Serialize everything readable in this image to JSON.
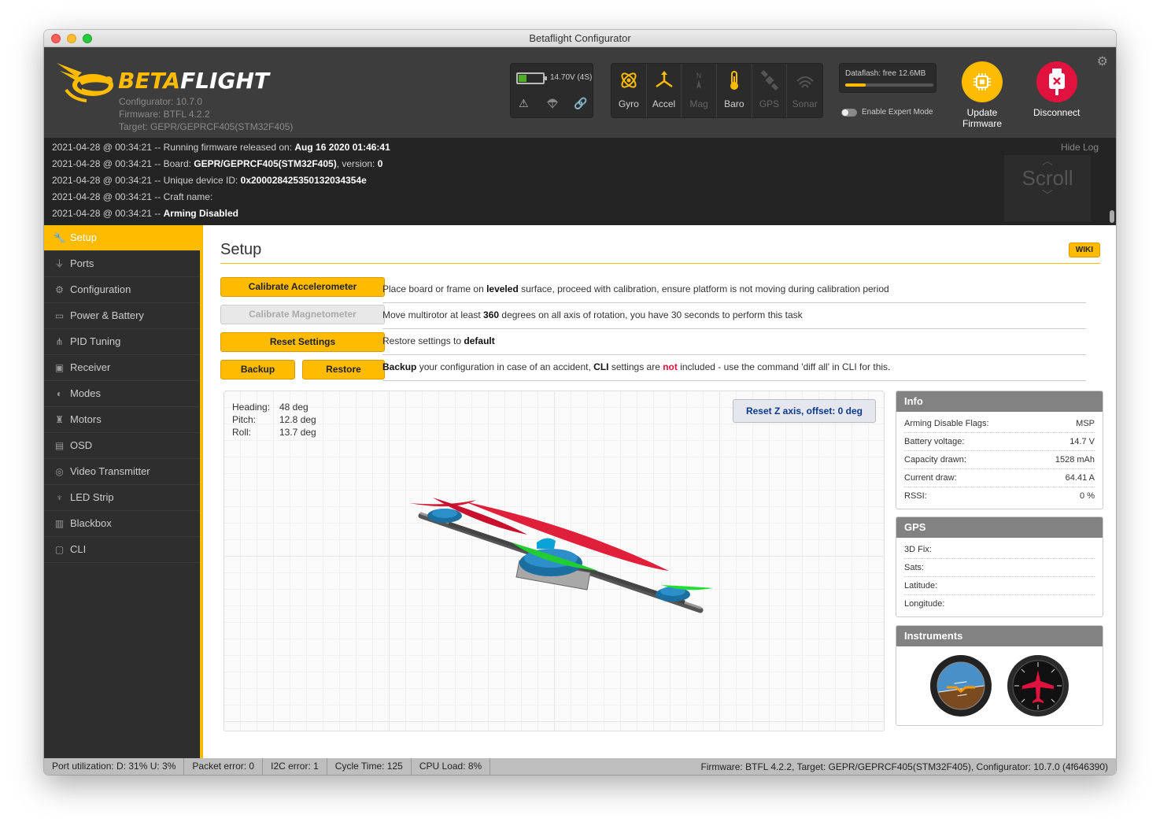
{
  "window": {
    "title": "Betaflight Configurator"
  },
  "header": {
    "brand_beta": "BETA",
    "brand_flight": "FLIGHT",
    "configurator_version": "Configurator: 10.7.0",
    "firmware_version": "Firmware: BTFL 4.2.2",
    "target": "Target: GEPR/GEPRCF405(STM32F405)",
    "battery_text": "14.70V (4S)",
    "battery_level": 0.3,
    "sensors": [
      {
        "label": "Gyro",
        "icon": "gyro-icon",
        "active": true
      },
      {
        "label": "Accel",
        "icon": "accel-icon",
        "active": true
      },
      {
        "label": "Mag",
        "icon": "mag-icon",
        "active": false
      },
      {
        "label": "Baro",
        "icon": "baro-icon",
        "active": true
      },
      {
        "label": "GPS",
        "icon": "gps-icon",
        "active": false
      },
      {
        "label": "Sonar",
        "icon": "sonar-icon",
        "active": false
      }
    ],
    "dataflash_text": "Dataflash: free 12.6MB",
    "dataflash_used_fraction": 0.23,
    "expert_mode_label": "Enable Expert Mode",
    "update_firmware_label_1": "Update",
    "update_firmware_label_2": "Firmware",
    "disconnect_label": "Disconnect",
    "accent_color": "#ffbb00",
    "disconnect_color": "#e2123f"
  },
  "log": {
    "hide_label": "Hide Log",
    "scroll_label": "Scroll",
    "lines": [
      {
        "prefix": "2021-04-28 @ 00:34:21 -- Running firmware released on: ",
        "bold": "Aug 16 2020 01:46:41",
        "suffix": ""
      },
      {
        "prefix": "2021-04-28 @ 00:34:21 -- Board: ",
        "bold": "GEPR/GEPRCF405(STM32F405)",
        "suffix": ", version: ",
        "bold2": "0"
      },
      {
        "prefix": "2021-04-28 @ 00:34:21 -- Unique device ID: ",
        "bold": "0x200028425350132034354e",
        "suffix": ""
      },
      {
        "prefix": "2021-04-28 @ 00:34:21 -- Craft name: ",
        "bold": "",
        "suffix": ""
      },
      {
        "prefix": "2021-04-28 @ 00:34:21 -- ",
        "bold": "Arming Disabled",
        "suffix": ""
      }
    ]
  },
  "sidebar": {
    "items": [
      {
        "label": "Setup",
        "icon": "wrench-icon",
        "active": true
      },
      {
        "label": "Ports",
        "icon": "plug-icon"
      },
      {
        "label": "Configuration",
        "icon": "gear-icon"
      },
      {
        "label": "Power & Battery",
        "icon": "battery-icon"
      },
      {
        "label": "PID Tuning",
        "icon": "sitemap-icon"
      },
      {
        "label": "Receiver",
        "icon": "receiver-icon"
      },
      {
        "label": "Modes",
        "icon": "toggles-icon"
      },
      {
        "label": "Motors",
        "icon": "motor-icon"
      },
      {
        "label": "OSD",
        "icon": "osd-icon"
      },
      {
        "label": "Video Transmitter",
        "icon": "broadcast-icon"
      },
      {
        "label": "LED Strip",
        "icon": "led-icon"
      },
      {
        "label": "Blackbox",
        "icon": "blackbox-icon"
      },
      {
        "label": "CLI",
        "icon": "terminal-icon"
      }
    ]
  },
  "setup": {
    "title": "Setup",
    "wiki_label": "WIKI",
    "calibrate_acc_label": "Calibrate Accelerometer",
    "calibrate_mag_label": "Calibrate Magnetometer",
    "reset_settings_label": "Reset Settings",
    "backup_label": "Backup",
    "restore_label": "Restore",
    "desc_acc": {
      "a": "Place board or frame on ",
      "b": "leveled",
      "c": " surface, proceed with calibration, ensure platform is not moving during calibration period"
    },
    "desc_mag": {
      "a": "Move multirotor at least ",
      "b": "360",
      "c": " degrees on all axis of rotation, you have 30 seconds to perform this task"
    },
    "desc_reset": {
      "a": "Restore settings to ",
      "b": "default"
    },
    "desc_backup": {
      "a": "Backup",
      "b": " your configuration in case of an accident, ",
      "c": "CLI",
      "d": " settings are ",
      "e": "not",
      "f": " included - use the command 'diff all' in CLI for this."
    },
    "attitude": [
      {
        "key": "Heading:",
        "value": "48 deg"
      },
      {
        "key": "Pitch:",
        "value": "12.8 deg"
      },
      {
        "key": "Roll:",
        "value": "13.7 deg"
      }
    ],
    "reset_z_label": "Reset Z axis, offset: 0 deg"
  },
  "info": {
    "title": "Info",
    "rows": [
      {
        "key": "Arming Disable Flags:",
        "value": "MSP"
      },
      {
        "key": "Battery voltage:",
        "value": "14.7 V"
      },
      {
        "key": "Capacity drawn:",
        "value": "1528 mAh"
      },
      {
        "key": "Current draw:",
        "value": "64.41 A"
      },
      {
        "key": "RSSI:",
        "value": "0 %"
      }
    ]
  },
  "gps": {
    "title": "GPS",
    "rows": [
      {
        "key": "3D Fix:",
        "value": ""
      },
      {
        "key": "Sats:",
        "value": ""
      },
      {
        "key": "Latitude:",
        "value": ""
      },
      {
        "key": "Longitude:",
        "value": ""
      }
    ]
  },
  "instruments": {
    "title": "Instruments"
  },
  "statusbar": {
    "port_util": "Port utilization: D: 31% U: 3%",
    "packet_error": "Packet error: 0",
    "i2c_error": "I2C error: 1",
    "cycle_time": "Cycle Time: 125",
    "cpu_load": "CPU Load: 8%",
    "firmware_info": "Firmware: BTFL 4.2.2, Target: GEPR/GEPRCF405(STM32F405), Configurator: 10.7.0 (4f646390)"
  }
}
